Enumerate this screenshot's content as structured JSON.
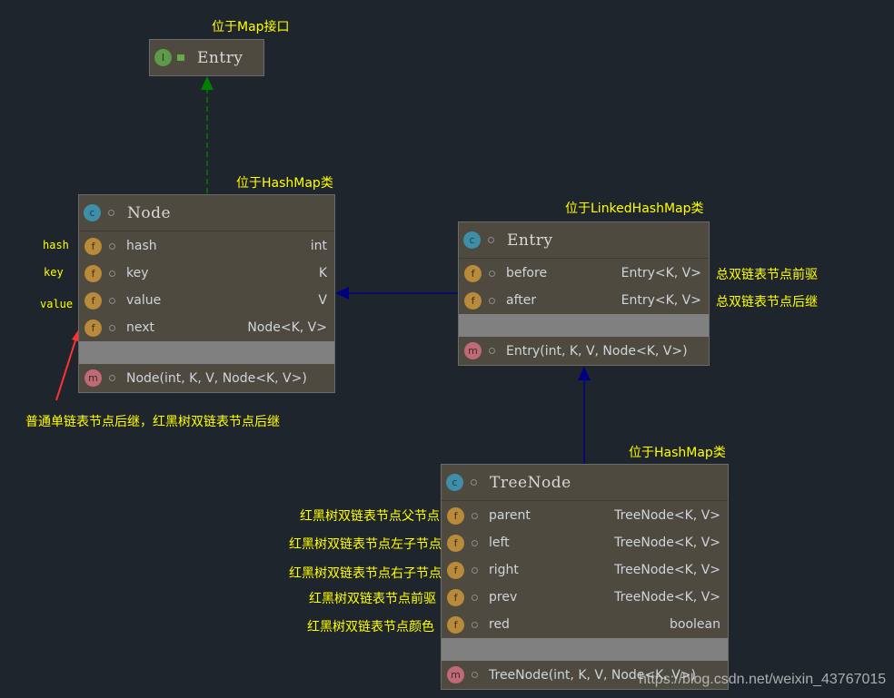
{
  "colors": {
    "background": "#1f252d",
    "box": "#4f4a3f",
    "annotation": "#ffff00",
    "implements_arrow": "#008000",
    "extends_arrow": "#000080",
    "pointer_arrow": "#ff3333"
  },
  "classes": [
    {
      "id": "map-entry",
      "kind": "interface",
      "icon": "interface-icon",
      "title": "Entry",
      "fields": [],
      "methods": []
    },
    {
      "id": "node",
      "kind": "class",
      "icon": "class-icon",
      "title": "Node",
      "fields": [
        {
          "name": "hash",
          "type": "int"
        },
        {
          "name": "key",
          "type": "K"
        },
        {
          "name": "value",
          "type": "V"
        },
        {
          "name": "next",
          "type": "Node<K, V>"
        }
      ],
      "methods": [
        "Node(int, K, V, Node<K, V>)"
      ]
    },
    {
      "id": "linked-entry",
      "kind": "class",
      "icon": "class-icon",
      "title": "Entry",
      "fields": [
        {
          "name": "before",
          "type": "Entry<K, V>"
        },
        {
          "name": "after",
          "type": "Entry<K, V>"
        }
      ],
      "methods": [
        "Entry(int, K, V, Node<K, V>)"
      ]
    },
    {
      "id": "treenode",
      "kind": "class",
      "icon": "class-icon",
      "title": "TreeNode",
      "fields": [
        {
          "name": "parent",
          "type": "TreeNode<K, V>"
        },
        {
          "name": "left",
          "type": "TreeNode<K, V>"
        },
        {
          "name": "right",
          "type": "TreeNode<K, V>"
        },
        {
          "name": "prev",
          "type": "TreeNode<K, V>"
        },
        {
          "name": "red",
          "type": "boolean"
        }
      ],
      "methods": [
        "TreeNode(int, K, V, Node<K, V>)"
      ]
    }
  ],
  "annotations": {
    "map_entry": "位于Map接口",
    "node": "位于HashMap类",
    "linked_entry": "位于LinkedHashMap类",
    "treenode": "位于HashMap类",
    "node_hash": "hash",
    "node_key": "key",
    "node_value": "value",
    "before": "总双链表节点前驱",
    "after": "总双链表节点后继",
    "next": "普通单链表节点后继，红黑树双链表节点后继",
    "parent": "红黑树双链表节点父节点",
    "left": "红黑树双链表节点左子节点",
    "right": "红黑树双链表节点右子节点",
    "prev": "红黑树双链表节点前驱",
    "red": "红黑树双链表节点颜色"
  },
  "watermark": "https://blog.csdn.net/weixin_43767015"
}
